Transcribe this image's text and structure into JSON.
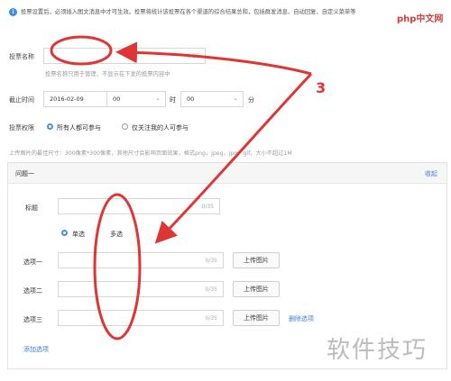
{
  "notice": {
    "icon": "info-icon",
    "text": "投票设置后，必须插入图文消息中才可生效。投票将统计该投票在各个渠道的综合结果总和，包括群发消息、自动回复、自定义菜单等"
  },
  "vote_name": {
    "label": "投票名称",
    "counter": "0/35",
    "hint": "投票名称只用于管理，不显示在下发的投票内容中"
  },
  "deadline": {
    "label": "截止时间",
    "date": "2016-02-09",
    "hour": "00",
    "hour_unit": "时",
    "minute": "00",
    "minute_unit": "分"
  },
  "permission": {
    "label": "投票权限",
    "options": [
      "所有人都可参与",
      "仅关注我的人可参与"
    ],
    "selected": 0
  },
  "upload_hint": "上传图片的最佳尺寸：300像素*300像素，其他尺寸会影响页面效果，格式png，jpeg，jpg，gif。大小不超过1M",
  "question": {
    "title": "问题一",
    "collapse": "收起",
    "title_label": "标题",
    "title_counter": "0/35",
    "type_options": [
      "单选",
      "多选"
    ],
    "selected_type": 0,
    "options": [
      {
        "label": "选项一",
        "counter": "0/35",
        "upload": "上传图片"
      },
      {
        "label": "选项二",
        "counter": "0/35",
        "upload": "上传图片"
      },
      {
        "label": "选项三",
        "counter": "0/35",
        "upload": "上传图片",
        "delete": "删除选项"
      }
    ],
    "add_option": "添加选项"
  },
  "annotation": {
    "number": "3",
    "color": "#e03535"
  },
  "watermarks": {
    "top_right": "php中文网",
    "bottom_right": "软件技巧"
  }
}
